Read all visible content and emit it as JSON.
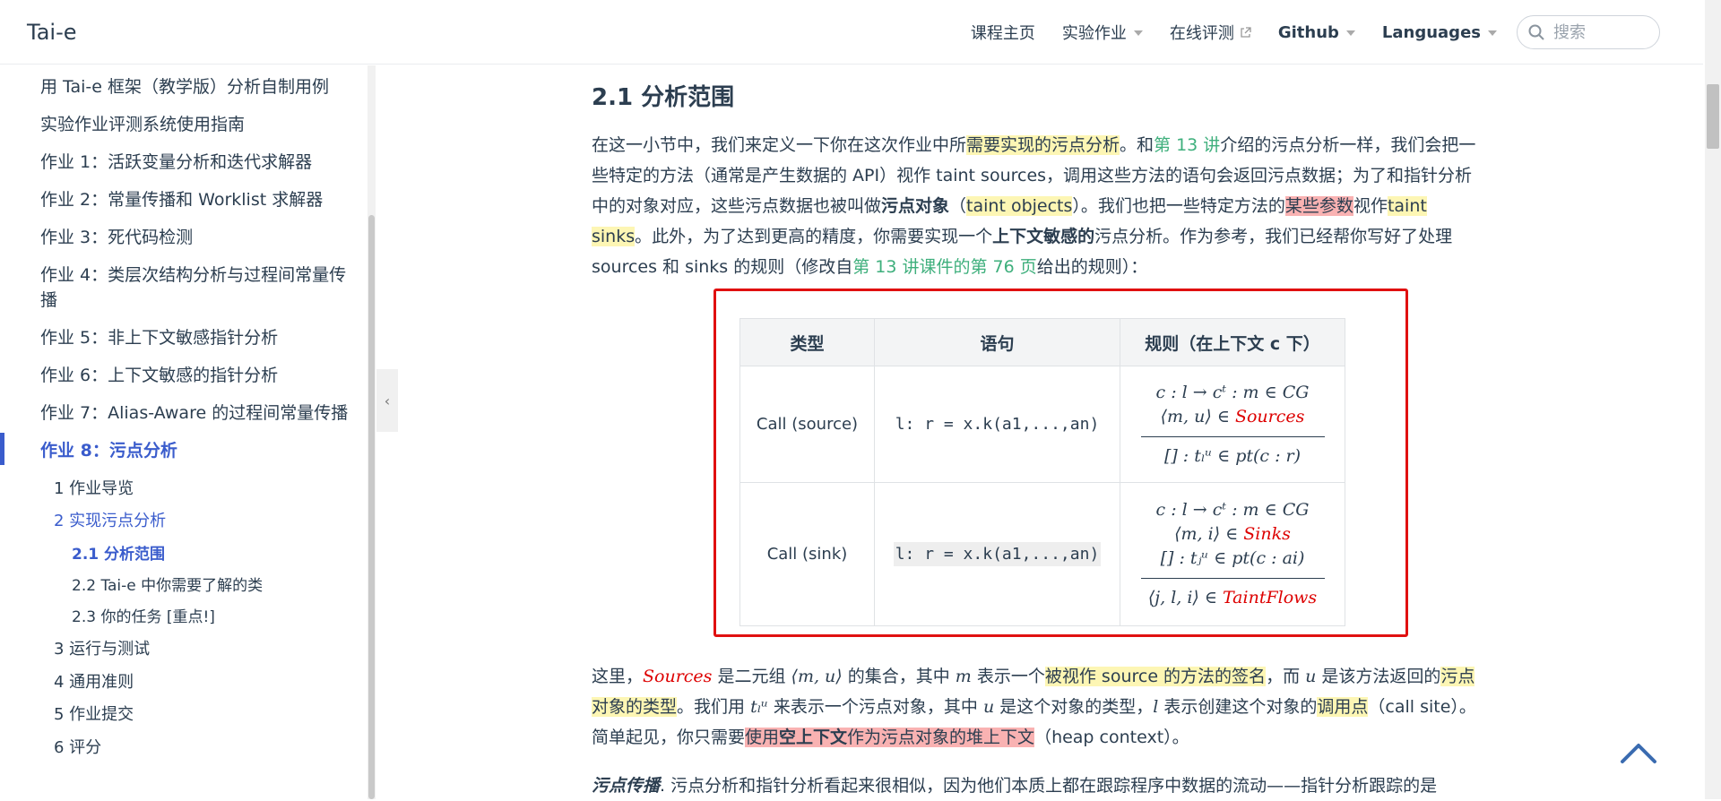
{
  "navbar": {
    "brand": "Tai-e",
    "links": [
      {
        "label": "课程主页"
      },
      {
        "label": "实验作业"
      },
      {
        "label": "在线评测"
      },
      {
        "label": "Github"
      },
      {
        "label": "Languages"
      }
    ],
    "search_placeholder": "搜索"
  },
  "sidebar": {
    "items": [
      "用 Tai-e 框架（教学版）分析自制用例",
      "实验作业评测系统使用指南",
      "作业 1：活跃变量分析和迭代求解器",
      "作业 2：常量传播和 Worklist 求解器",
      "作业 3：死代码检测",
      "作业 4：类层次结构分析与过程间常量传播",
      "作业 5：非上下文敏感指针分析",
      "作业 6：上下文敏感的指针分析",
      "作业 7：Alias-Aware 的过程间常量传播",
      "作业 8：污点分析"
    ],
    "sub_items": [
      "1 作业导览",
      "2 实现污点分析",
      "3 运行与测试",
      "4 通用准则",
      "5 作业提交",
      "6 评分"
    ],
    "sub_sub_items": [
      "2.1 分析范围",
      "2.2 Tai-e 中你需要了解的类",
      "2.3 你的任务 [重点!]"
    ]
  },
  "content": {
    "heading": "2.1 分析范围",
    "p1": {
      "t1": "在这一小节中，我们来定义一下你在这次作业中所",
      "h1": "需要实现的污点分析",
      "t2": "。和",
      "l1": "第 13 讲",
      "t3": "介绍的污点分析一样，我们会把一些特定的方法（通常是产生数据的 API）视作 taint sources，调用这些方法的语句会返回污点数据；为了和指针分析中的对象对应，这些污点数据也被叫做",
      "b1": "污点对象",
      "t4": "（",
      "h2": "taint objects",
      "t5": "）。我们也把一些特定方法的",
      "h3": "某些参数",
      "t6": "视作",
      "h4": "taint sinks",
      "t7": "。此外，为了达到更高的精度，你需要实现一个",
      "b2": "上下文敏感的",
      "t8": "污点分析。作为参考，我们已经帮你写好了处理 sources 和 sinks 的规则（修改自",
      "l2": "第 13 讲课件的第 76 页",
      "t9": "给出的规则）："
    },
    "table": {
      "headers": [
        "类型",
        "语句",
        "规则（在上下文 c 下）"
      ],
      "rows": [
        {
          "type": "Call (source)",
          "stmt": "l: r = x.k(a1,...,an)",
          "premises": [
            "c : l → cᵗ : m ∈ CG",
            "⟨m, u⟩ ∈ "
          ],
          "premise_red": "Sources",
          "conclusion": "[] : tₗᵘ ∈ pt(c : r)"
        },
        {
          "type": "Call (sink)",
          "stmt": "l: r = x.k(a1,...,an)",
          "premises": [
            "c : l → cᵗ : m ∈ CG",
            "⟨m, i⟩ ∈ ",
            "[] : tⱼᵘ ∈ pt(c : ai)"
          ],
          "premise_red": "Sinks",
          "conclusion": "⟨j, l, i⟩ ∈ ",
          "conclusion_red": "TaintFlows"
        }
      ]
    },
    "p2": {
      "t1": "这里，",
      "m1": "Sources",
      "t2": " 是二元组 ",
      "m2": "⟨m, u⟩",
      "t3": " 的集合，其中 ",
      "m3": "m",
      "t4": " 表示一个",
      "h1": "被视作 source 的方法的签名",
      "t5": "，而 ",
      "m4": "u",
      "t6": " 是该方法返回的",
      "h2": "污点对象的类型",
      "t7": "。我们用 ",
      "m5": "tₗᵘ",
      "t8": " 来表示一个污点对象，其中 ",
      "m6": "u",
      "t9": " 是这个对象的类型，",
      "m7": "l",
      "t10": " 表示创建这个对象的",
      "h3": "调用点",
      "t11": "（call site）。简单起见，你只需要",
      "r1": "使用",
      "rb": "空上下文",
      "r2": "作为污点对象的堆上下文",
      "t12": "（heap context）。"
    },
    "p3": {
      "b1": "污点传播",
      "t1": ". 污点分析和指针分析看起来很相似，因为他们本质上都在跟踪程序中数据的流动——指针分析跟踪的是"
    }
  }
}
